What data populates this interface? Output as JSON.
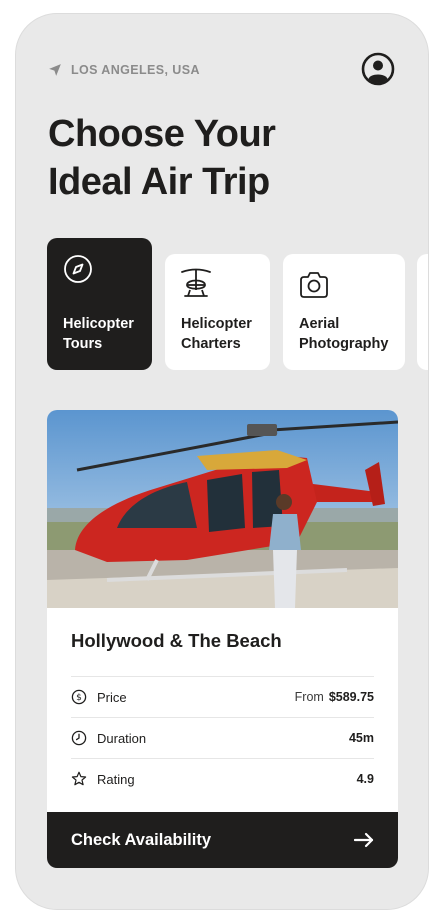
{
  "header": {
    "location": "LOS ANGELES, USA",
    "location_icon": "navigation-arrow-icon",
    "profile_icon": "user-circle-icon"
  },
  "title": {
    "line1": "Choose Your",
    "line2": "Ideal Air Trip"
  },
  "categories": [
    {
      "line1": "Helicopter",
      "line2": "Tours",
      "icon": "compass-icon",
      "active": true
    },
    {
      "line1": "Helicopter",
      "line2": "Charters",
      "icon": "helicopter-icon",
      "active": false
    },
    {
      "line1": "Aerial",
      "line2": "Photography",
      "icon": "camera-icon",
      "active": false
    }
  ],
  "tour": {
    "title": "Hollywood & The Beach",
    "rows": [
      {
        "label": "Price",
        "prefix": "From",
        "value": "$589.75",
        "icon": "dollar-icon"
      },
      {
        "label": "Duration",
        "value": "45m",
        "icon": "clock-icon"
      },
      {
        "label": "Rating",
        "value": "4.9",
        "icon": "star-icon"
      }
    ],
    "cta_label": "Check Availability",
    "cta_icon": "arrow-right-icon"
  },
  "colors": {
    "background": "#e9e9e9",
    "dark": "#1f1e1d",
    "card": "#ffffff",
    "muted_text": "#8b8b8b"
  }
}
